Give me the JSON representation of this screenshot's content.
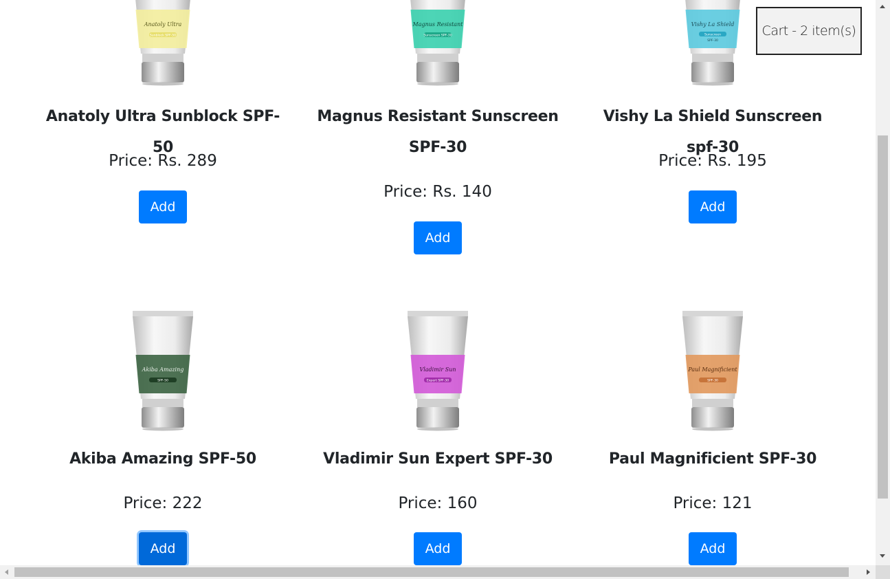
{
  "cart": {
    "label": "Cart - 2 item(s)"
  },
  "products": [
    {
      "name": "Anatoly Ultra Sunblock SPF-50",
      "price": "Price: Rs. 289",
      "button": "Add",
      "tube": {
        "band_color": "#f3ee9e",
        "brand": "Anatoly Ultra",
        "sub": "Sunblock SPF-50",
        "text_color": "#5a5a1e",
        "sub_bg": "#e8df6e"
      }
    },
    {
      "name": "Magnus Resistant Sunscreen SPF-30",
      "price": "Price: Rs. 140",
      "button": "Add",
      "tube": {
        "band_color": "#3ed1b0",
        "brand": "Magnus Resistant",
        "sub": "Sunscreen SPF-30",
        "text_color": "#0e4a3e",
        "sub_bg": "#1ea889"
      }
    },
    {
      "name": "Vishy La Shield Sunscreen spf-30",
      "price": "Price: Rs. 195",
      "button": "Add",
      "tube": {
        "band_color": "#5ecbe0",
        "brand": "Vishy La Shield",
        "sub": "Sunscreen",
        "sub2": "SPF-30",
        "text_color": "#1d4f5a",
        "sub_bg": "#2aa8c4"
      }
    },
    {
      "name": "Akiba Amazing SPF-50",
      "price": "Price: 222",
      "button": "Add",
      "tube": {
        "band_color": "#3f6645",
        "brand": "Akiba Amazing",
        "sub": "SPF-50",
        "text_color": "#e8efe8",
        "sub_bg": "#1f3f25"
      }
    },
    {
      "name": "Vladimir Sun Expert SPF-30",
      "price": "Price: 160",
      "button": "Add",
      "tube": {
        "band_color": "#d25cd8",
        "brand": "Vladimir Sun",
        "sub": "Expert SPF-30",
        "text_color": "#3b0f3e",
        "sub_bg": "#a32fab"
      }
    },
    {
      "name": "Paul Magnificient SPF-30",
      "price": "Price: 121",
      "button": "Add",
      "tube": {
        "band_color": "#e29a60",
        "brand": "Paul Magnificient",
        "sub": "SPF-30",
        "text_color": "#5a2e10",
        "sub_bg": "#c7743a"
      }
    }
  ]
}
